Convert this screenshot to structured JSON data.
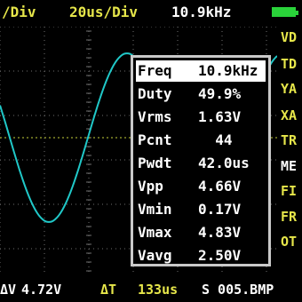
{
  "header": {
    "volt_div": "/Div",
    "time_div": "20us/Div",
    "frequency": "10.9kHz",
    "battery_icon": "battery-full-icon",
    "battery_color": "#2ad33a"
  },
  "menu": {
    "items": [
      {
        "label": "VD",
        "active": false
      },
      {
        "label": "TD",
        "active": false
      },
      {
        "label": "YA",
        "active": false
      },
      {
        "label": "XA",
        "active": false
      },
      {
        "label": "TR",
        "active": false
      },
      {
        "label": "ME",
        "active": true
      },
      {
        "label": "FI",
        "active": false
      },
      {
        "label": "FR",
        "active": false
      },
      {
        "label": "OT",
        "active": false
      }
    ]
  },
  "measurements": [
    {
      "label": "Freq",
      "value": "10.9kHz",
      "selected": true
    },
    {
      "label": "Duty",
      "value": "49.9%",
      "selected": false
    },
    {
      "label": "Vrms",
      "value": "1.63V",
      "selected": false
    },
    {
      "label": "Pcnt",
      "value": "  44",
      "selected": false
    },
    {
      "label": "Pwdt",
      "value": "42.0us",
      "selected": false
    },
    {
      "label": "Vpp",
      "value": "4.66V",
      "selected": false
    },
    {
      "label": "Vmin",
      "value": "0.17V",
      "selected": false
    },
    {
      "label": "Vmax",
      "value": "4.83V",
      "selected": false
    },
    {
      "label": "Vavg",
      "value": "2.50V",
      "selected": false
    }
  ],
  "footer": {
    "delta_v_label": "ΔV",
    "delta_v_value": "4.72V",
    "delta_t_label": "ΔT",
    "delta_t_value": "133us",
    "file_label": "S 005.BMP"
  },
  "colors": {
    "trace": "#20c8c8",
    "grid": "#707070",
    "trigger_level": "#c8d23c",
    "label_yellow": "#e6e64a",
    "panel_border": "#c9c9c9"
  }
}
